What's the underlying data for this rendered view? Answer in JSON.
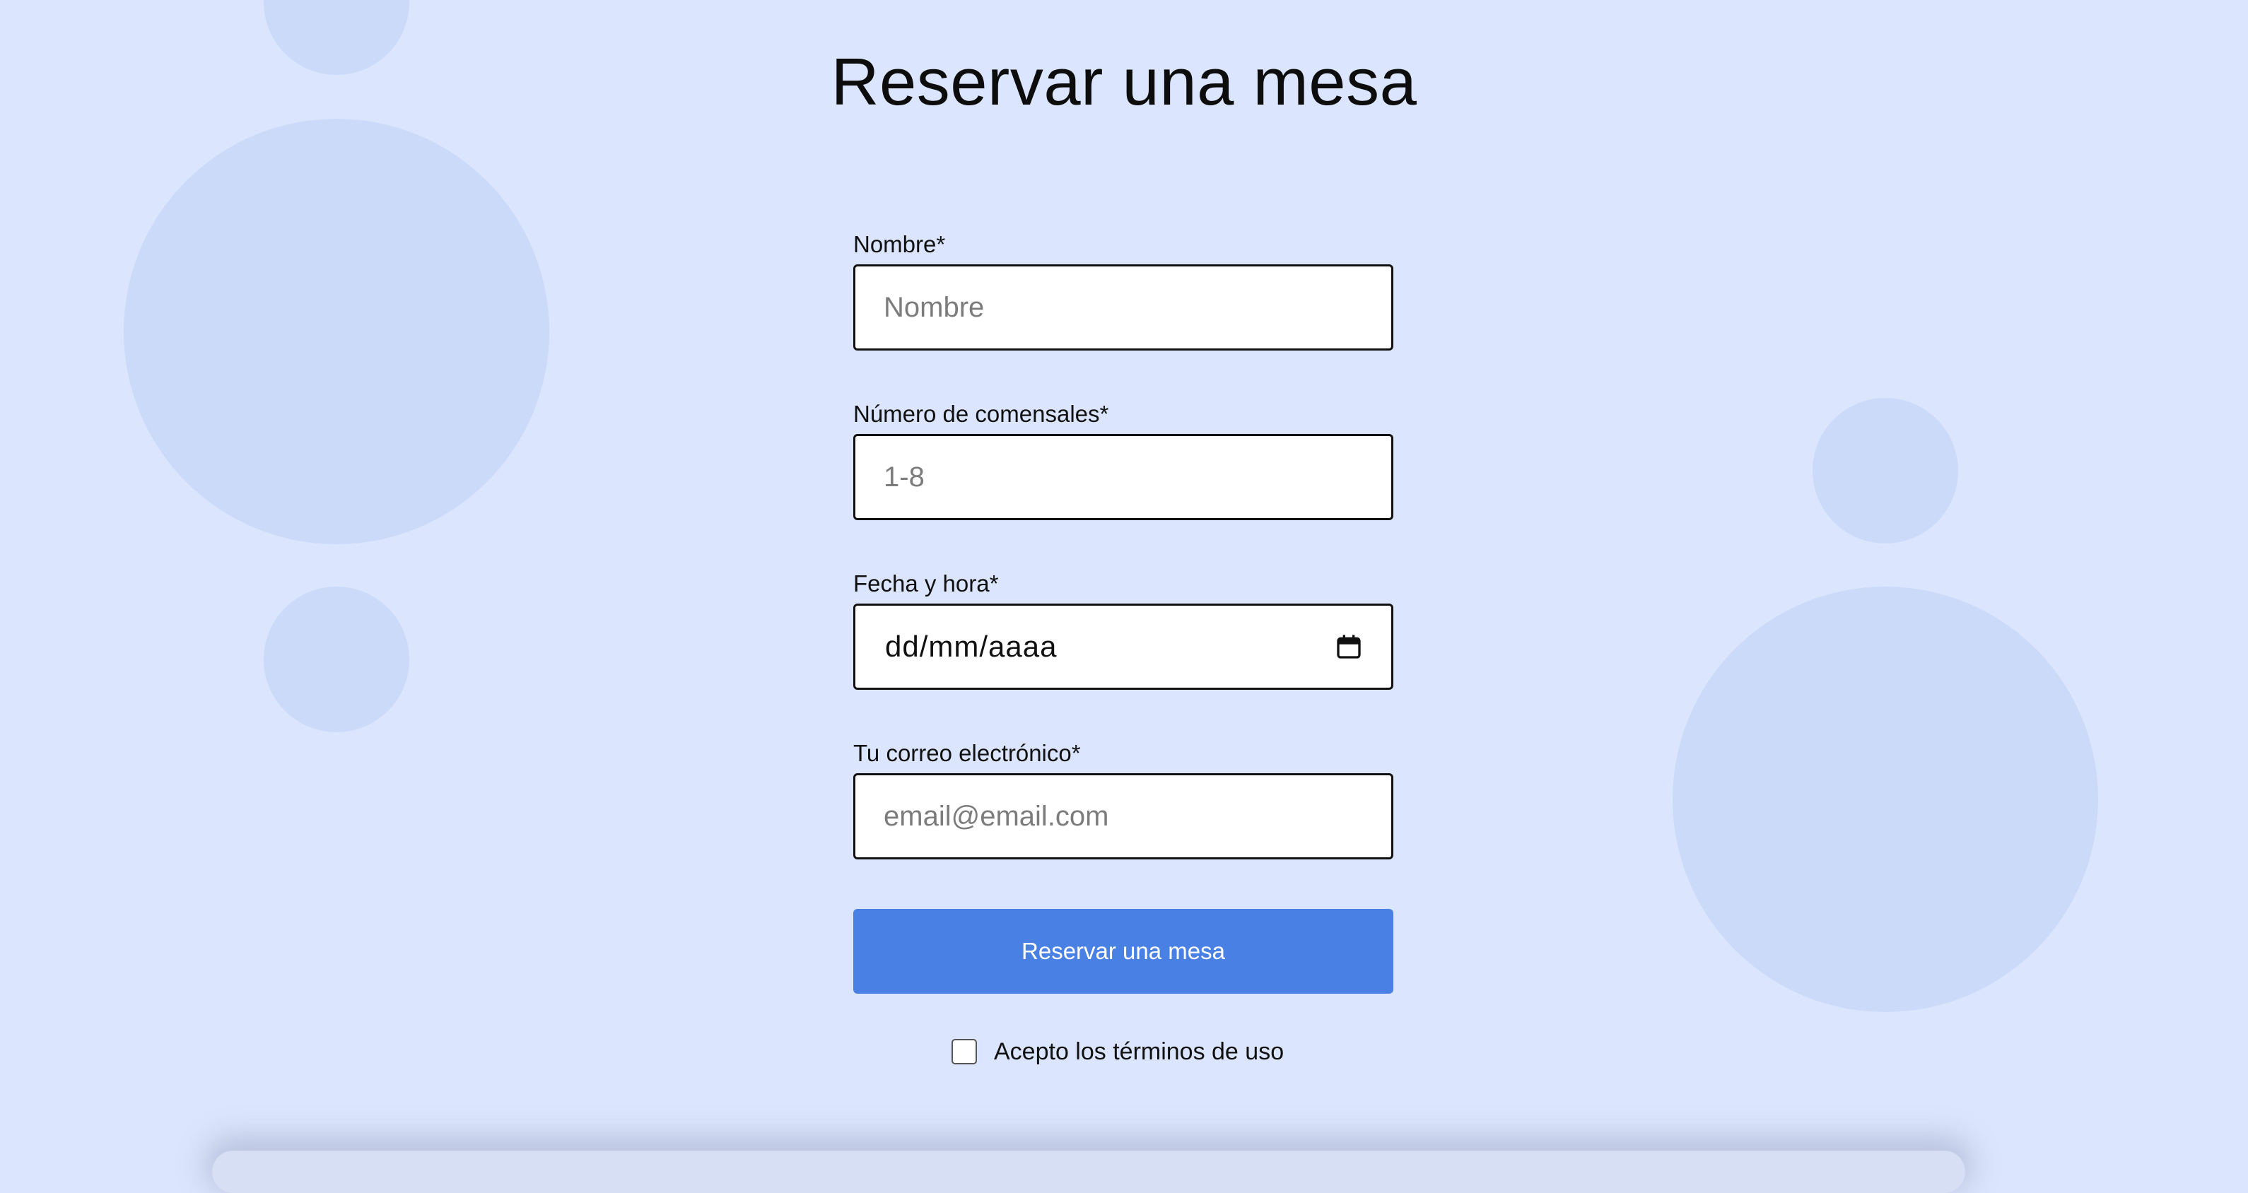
{
  "page": {
    "title": "Reservar una mesa",
    "background_color": "#dbe5fd",
    "accent_color": "#4880e4"
  },
  "form": {
    "name": {
      "label": "Nombre*",
      "placeholder": "Nombre",
      "value": ""
    },
    "guests": {
      "label": "Número de comensales*",
      "placeholder": "1-8",
      "value": ""
    },
    "datetime": {
      "label": "Fecha y hora*",
      "display": "dd/mm/aaaa",
      "icon": "calendar-icon"
    },
    "email": {
      "label": "Tu correo electrónico*",
      "placeholder": "email@email.com",
      "value": ""
    },
    "submit_label": "Reservar una mesa",
    "terms": {
      "label": "Acepto los términos de uso",
      "checked": false
    }
  }
}
